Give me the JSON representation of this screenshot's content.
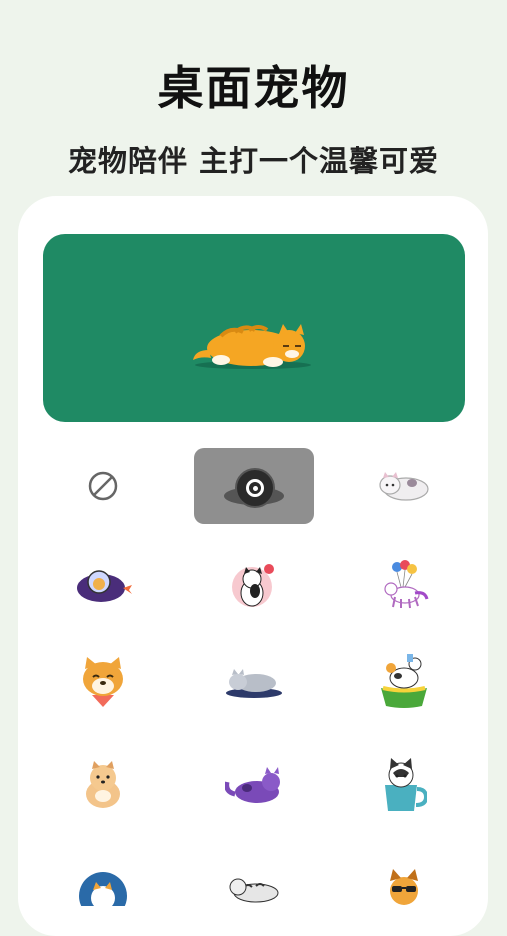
{
  "header": {
    "title": "桌面宠物",
    "subtitle": "宠物陪伴 主打一个温馨可爱"
  },
  "preview": {
    "pet": "orange-tabby-cat-lying-icon",
    "background_color": "#1f8a64"
  },
  "pet_grid": {
    "selected_index": 1,
    "items": [
      {
        "icon": "none-icon"
      },
      {
        "icon": "cat-in-tire-icon"
      },
      {
        "icon": "white-cat-lying-icon"
      },
      {
        "icon": "astronaut-cat-ufo-icon"
      },
      {
        "icon": "black-white-cat-heart-icon"
      },
      {
        "icon": "unicorn-balloons-icon"
      },
      {
        "icon": "shiba-inu-face-icon"
      },
      {
        "icon": "grey-cat-sleeping-icon"
      },
      {
        "icon": "cow-in-bowl-icon"
      },
      {
        "icon": "pomeranian-dog-icon"
      },
      {
        "icon": "purple-cat-lying-icon"
      },
      {
        "icon": "husky-in-cup-icon"
      },
      {
        "icon": "cat-in-circle-icon"
      },
      {
        "icon": "tabby-cat-lying-icon"
      },
      {
        "icon": "dog-with-sunglasses-icon"
      }
    ]
  }
}
